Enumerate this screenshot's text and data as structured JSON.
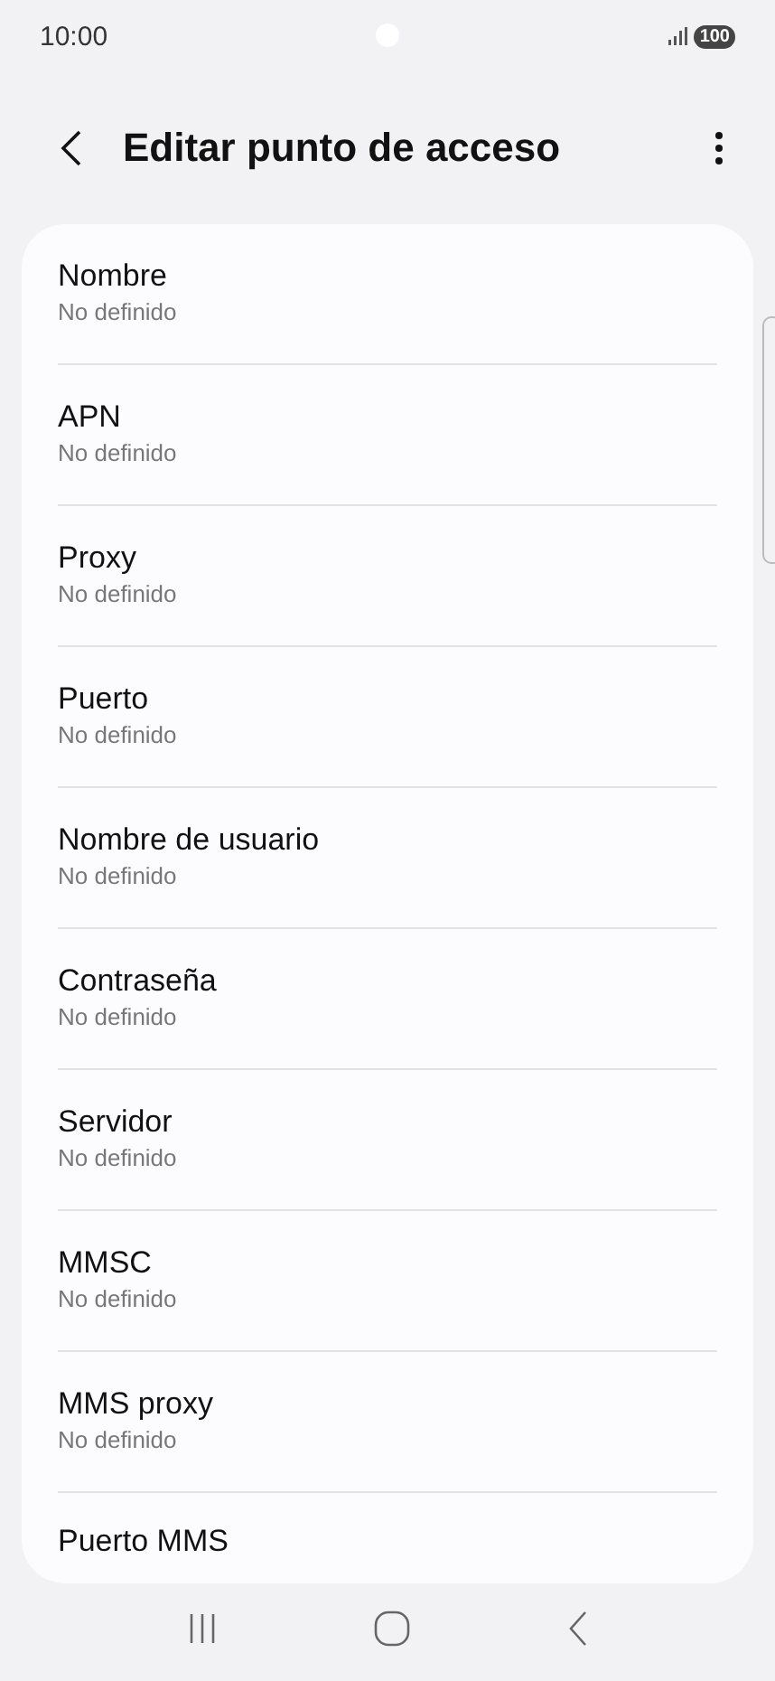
{
  "status_bar": {
    "time": "10:00",
    "battery": "100"
  },
  "header": {
    "title": "Editar punto de acceso"
  },
  "settings": [
    {
      "label": "Nombre",
      "value": "No definido"
    },
    {
      "label": "APN",
      "value": "No definido"
    },
    {
      "label": "Proxy",
      "value": "No definido"
    },
    {
      "label": "Puerto",
      "value": "No definido"
    },
    {
      "label": "Nombre de usuario",
      "value": "No definido"
    },
    {
      "label": "Contraseña",
      "value": "No definido"
    },
    {
      "label": "Servidor",
      "value": "No definido"
    },
    {
      "label": "MMSC",
      "value": "No definido"
    },
    {
      "label": "MMS proxy",
      "value": "No definido"
    },
    {
      "label": "Puerto MMS"
    }
  ]
}
